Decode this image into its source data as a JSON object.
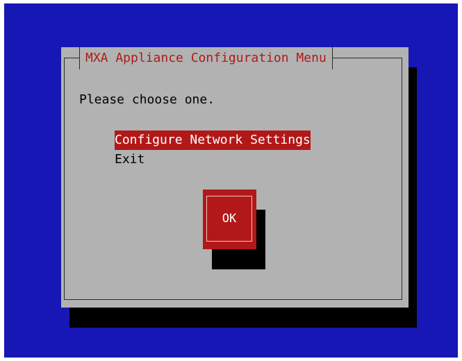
{
  "dialog": {
    "title": "MXA Appliance Configuration Menu",
    "prompt": "Please choose one.",
    "menu_items": [
      {
        "label": "Configure Network Settings",
        "selected": true
      },
      {
        "label": "Exit",
        "selected": false
      }
    ],
    "ok_label": "OK"
  },
  "colors": {
    "background": "#1717b5",
    "dialog": "#b2b2b2",
    "accent": "#b21818",
    "shadow": "#000000"
  }
}
